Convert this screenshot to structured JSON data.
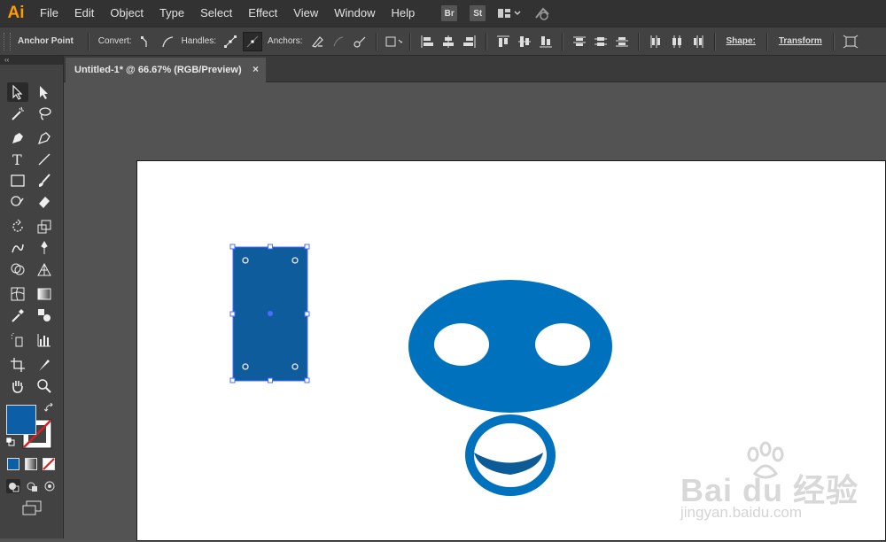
{
  "app": {
    "logo": "Ai",
    "brand_color": "#ff9a00"
  },
  "menu": {
    "items": [
      "File",
      "Edit",
      "Object",
      "Type",
      "Select",
      "Effect",
      "View",
      "Window",
      "Help"
    ],
    "bridge_label": "Br",
    "stock_label": "St"
  },
  "control_bar": {
    "title": "Anchor Point",
    "convert_label": "Convert:",
    "handles_label": "Handles:",
    "anchors_label": "Anchors:",
    "shape_label": "Shape:",
    "transform_label": "Transform"
  },
  "document": {
    "tab_title": "Untitled-1* @ 66.67% (RGB/Preview)",
    "close_glyph": "×"
  },
  "tool_panel": {
    "collapse_glyph": "‹‹",
    "fill_color": "#0c5ea6",
    "stroke": "none"
  },
  "artwork": {
    "rect_color": "#0e5c9c",
    "face_color": "#0071bc",
    "selection_color": "#4a6cff"
  },
  "watermark": {
    "logo_text": "Bai du 经验",
    "url": "jingyan.baidu.com"
  }
}
